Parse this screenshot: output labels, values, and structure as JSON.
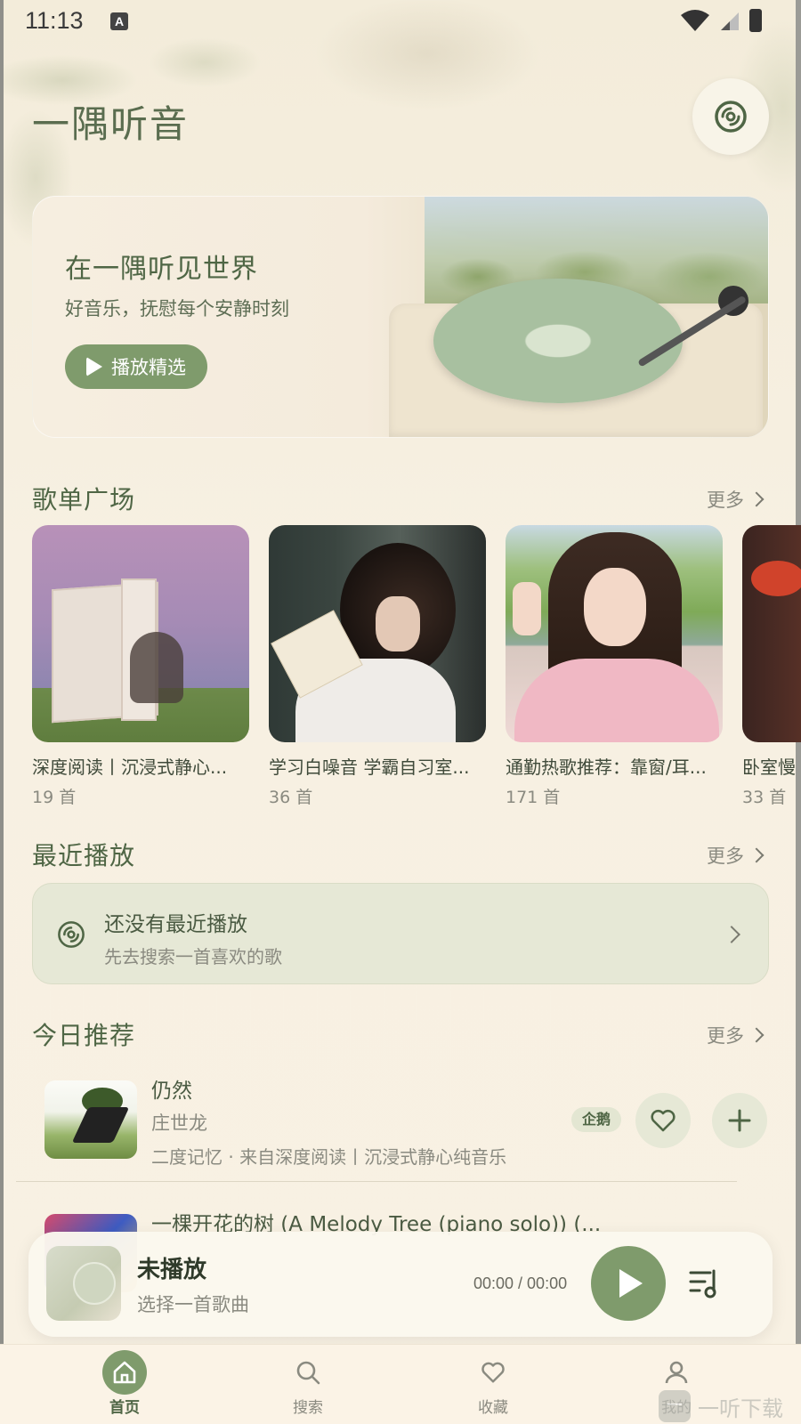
{
  "status_bar": {
    "time": "11:13",
    "input_indicator": "A"
  },
  "header": {
    "title": "一隅听音"
  },
  "hero": {
    "title": "在一隅听见世界",
    "subtitle": "好音乐，抚慰每个安静时刻",
    "play_label": "播放精选"
  },
  "playlists": {
    "title": "歌单广场",
    "more": "更多",
    "items": [
      {
        "name": "深度阅读丨沉浸式静心...",
        "count": "19 首"
      },
      {
        "name": "学习白噪音 学霸自习室...",
        "count": "36 首"
      },
      {
        "name": "通勤热歌推荐：靠窗/耳...",
        "count": "171 首"
      },
      {
        "name": "卧室慢",
        "count": "33 首"
      }
    ]
  },
  "recent": {
    "title": "最近播放",
    "more": "更多",
    "empty_title": "还没有最近播放",
    "empty_sub": "先去搜索一首喜欢的歌"
  },
  "recommend": {
    "title": "今日推荐",
    "more": "更多",
    "songs": [
      {
        "title": "仍然",
        "artist": "庄世龙",
        "meta": "二度记忆 · 来自深度阅读丨沉浸式静心纯音乐",
        "source": "企鹅"
      },
      {
        "title": "一棵开花的树 (A Melody Tree (piano solo)) (..."
      }
    ]
  },
  "player": {
    "title": "未播放",
    "subtitle": "选择一首歌曲",
    "time": "00:00 / 00:00"
  },
  "nav": {
    "items": [
      {
        "label": "首页",
        "icon": "home-icon",
        "active": true
      },
      {
        "label": "搜索",
        "icon": "search-icon",
        "active": false
      },
      {
        "label": "收藏",
        "icon": "heart-icon",
        "active": false
      },
      {
        "label": "我的",
        "icon": "user-icon",
        "active": false
      }
    ]
  },
  "watermark": {
    "text": "一听下载"
  },
  "colors": {
    "accent": "#7f9b6c",
    "title": "#4f6645",
    "background": "#f7f0e2",
    "chip": "#e6e8d6"
  }
}
